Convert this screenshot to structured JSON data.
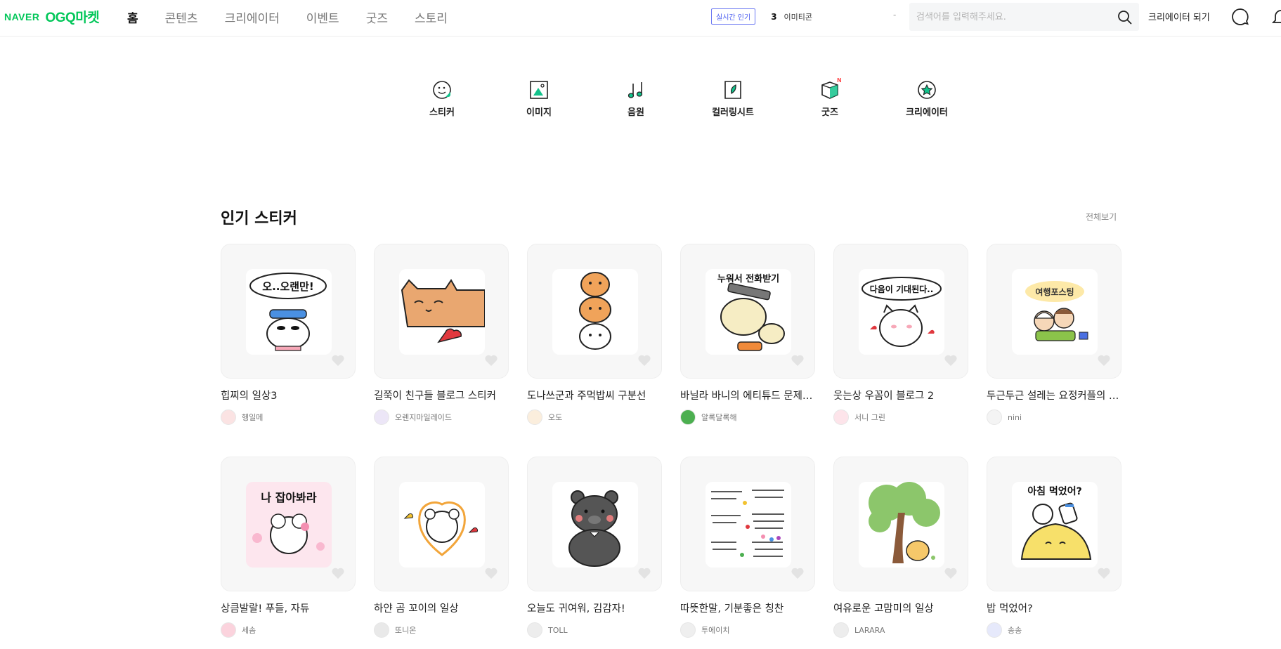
{
  "header": {
    "logo_naver": "NAVER",
    "logo_ogq": "OGQ",
    "logo_market": "마켓",
    "nav": [
      {
        "label": "홈",
        "active": true
      },
      {
        "label": "콘텐츠",
        "active": false
      },
      {
        "label": "크리에이터",
        "active": false
      },
      {
        "label": "이벤트",
        "active": false
      },
      {
        "label": "굿즈",
        "active": false
      },
      {
        "label": "스토리",
        "active": false
      }
    ],
    "trend_badge": "실시간 인기",
    "trend_rank": "3",
    "trend_word": "이미티콘",
    "dash": "-",
    "search_placeholder": "검색어를 입력해주세요.",
    "be_creator": "크리에이터 되기"
  },
  "categories": [
    {
      "label": "스티커",
      "icon": "sticker-icon"
    },
    {
      "label": "이미지",
      "icon": "image-icon"
    },
    {
      "label": "음원",
      "icon": "music-icon"
    },
    {
      "label": "컬러링시트",
      "icon": "coloring-icon"
    },
    {
      "label": "굿즈",
      "icon": "goods-icon",
      "badge": "N"
    },
    {
      "label": "크리에이터",
      "icon": "creator-icon"
    }
  ],
  "section": {
    "title": "인기 스티커",
    "see_all": "전체보기"
  },
  "stickers": [
    {
      "title": "힙찌의 일상3",
      "author": "헹일메",
      "art_text": "오..오랜만!"
    },
    {
      "title": "길쭉이 친구들 블로그 스티커",
      "author": "오렌지마일레이드",
      "art_text": ""
    },
    {
      "title": "도나쓰군과 주먹밥씨 구분선",
      "author": "오도",
      "art_text": ""
    },
    {
      "title": "바닐라 바니의 에티튜드 문제…",
      "author": "알록달록해",
      "art_text": "누워서 전화받기"
    },
    {
      "title": "웃는상 우꼼이 블로그 2",
      "author": "서니 그린",
      "art_text": "다음이 기대된다.."
    },
    {
      "title": "두근두근 설레는 요정커플의 …",
      "author": "nini",
      "art_text": "여행포스팅"
    },
    {
      "title": "상큼발랄! 푸들, 자듀",
      "author": "세솜",
      "art_text": "나 잡아봐라"
    },
    {
      "title": "하얀 곰 꼬이의 일상",
      "author": "또니온",
      "art_text": ""
    },
    {
      "title": "오늘도 귀여워, 김감자!",
      "author": "TOLL",
      "art_text": ""
    },
    {
      "title": "따뜻한말, 기분좋은 칭찬",
      "author": "투에이치",
      "art_text": ""
    },
    {
      "title": "여유로운 고맘미의 일상",
      "author": "LARARA",
      "art_text": ""
    },
    {
      "title": "밥 먹었어?",
      "author": "송송",
      "art_text": "아침 먹었어?"
    }
  ],
  "colors": {
    "brand": "#03c75a",
    "trend_badge": "#4a5cf0",
    "new_badge": "#ff4d4f"
  }
}
